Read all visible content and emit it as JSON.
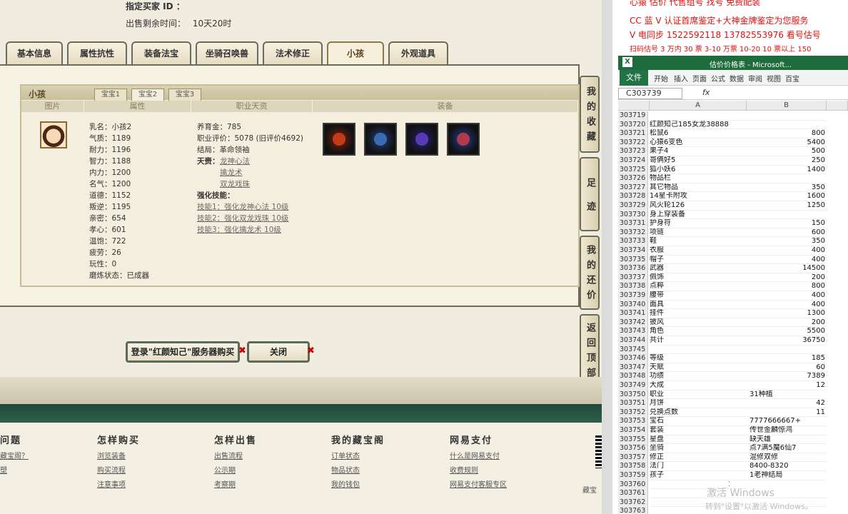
{
  "header": {
    "buyer_label": "指定买家 ID ：",
    "time_label": "出售剩余时间：",
    "time_value": "10天20时"
  },
  "tabs": [
    {
      "label": "基本信息"
    },
    {
      "label": "属性抗性"
    },
    {
      "label": "装备法宝"
    },
    {
      "label": "坐骑召唤兽"
    },
    {
      "label": "法术修正"
    },
    {
      "label": "小孩"
    },
    {
      "label": "外观道具"
    }
  ],
  "child_panel": {
    "title": "小孩",
    "subtabs": [
      "宝宝1",
      "宝宝2",
      "宝宝3"
    ],
    "columns": [
      "图片",
      "属性",
      "职业天资",
      "装备"
    ],
    "attributes": [
      "乳名：小孩2",
      "气质：1189",
      "耐力：1196",
      "智力：1188",
      "内力：1200",
      "名气：1200",
      "道德：1152",
      "叛逆：1195",
      "亲密：654",
      "孝心：601",
      "温饱：722",
      "疲劳：26",
      "玩性：0",
      "磨炼状态：已成器"
    ],
    "career": {
      "fee": "养育金：785",
      "rating": "职业评价：5078 (旧评价4692)",
      "ending": "结局：革命领袖",
      "talent_label": "天赍：",
      "talents": [
        "龙神心法",
        "擒龙术",
        "双龙戏珠"
      ],
      "skills_label": "强化技能：",
      "skills": [
        "技能1：强化龙神心法 10级",
        "技能2：强化双龙戏珠 10级",
        "技能3：强化擒龙术 10级"
      ]
    },
    "equip_icons": [
      "equip-1-icon",
      "equip-2-icon",
      "equip-3-icon",
      "equip-4-icon"
    ]
  },
  "side_buttons": [
    "我的收藏",
    "足迹",
    "我的还价",
    "返回顶部"
  ],
  "actions": {
    "login_buy": "登录\"红颜知己\"服务器购买",
    "close": "关闭",
    "x_mark": "✖"
  },
  "footer": {
    "sections": [
      {
        "title": "问题",
        "links": [
          "藏宝阁？",
          "塑"
        ]
      },
      {
        "title": "怎样购买",
        "links": [
          "浏览装备",
          "购买流程",
          "注意事项"
        ]
      },
      {
        "title": "怎样出售",
        "links": [
          "出售流程",
          "公示期",
          "考察期"
        ]
      },
      {
        "title": "我的藏宝阁",
        "links": [
          "订单状态",
          "物品状态",
          "我的钱包"
        ]
      },
      {
        "title": "网易支付",
        "links": [
          "什么是网易支付",
          "收费规则",
          "网易支付客服专区"
        ]
      }
    ],
    "corner_text": "藏宝"
  },
  "right_panel": {
    "banner": [
      "心猿 估价 代售组号 找号 免费配装",
      "CC 蓝 V 认证首席鉴定+大神金牌鉴定为您服务",
      "V 电同步 1522592118 13782553976 看号估号",
      "扫码估号 3 万内 30 票 3-10 万票 10-20 10 票以上 150"
    ],
    "window_title": "估价价格表 - Microsoft...",
    "ribbon_tabs": [
      "文件",
      "开始",
      "插入",
      "页面",
      "公式",
      "数据",
      "审阅",
      "视图",
      "百宝"
    ],
    "name_box": "C303739",
    "fx_label": "fx",
    "col_headers": [
      "A",
      "B"
    ],
    "rows": [
      {
        "n": "303719",
        "a": "",
        "b": ""
      },
      {
        "n": "303720",
        "a": "红颜知己185女龙38888",
        "b": ""
      },
      {
        "n": "303721",
        "a": "松鼠6",
        "b": "800"
      },
      {
        "n": "303722",
        "a": "心猿6变色",
        "b": "5400"
      },
      {
        "n": "303723",
        "a": "果子4",
        "b": "500"
      },
      {
        "n": "303724",
        "a": "哥俩好5",
        "b": "250"
      },
      {
        "n": "303725",
        "a": "狐小妖6",
        "b": "1400"
      },
      {
        "n": "303726",
        "a": "物品栏",
        "b": ""
      },
      {
        "n": "303727",
        "a": "其它物品",
        "b": "350"
      },
      {
        "n": "303728",
        "a": "14星卡附攻",
        "b": "1600"
      },
      {
        "n": "303729",
        "a": "风火轮126",
        "b": "1250"
      },
      {
        "n": "303730",
        "a": "身上穿装备",
        "b": ""
      },
      {
        "n": "303731",
        "a": "护身符",
        "b": "150"
      },
      {
        "n": "303732",
        "a": "项链",
        "b": "600"
      },
      {
        "n": "303733",
        "a": "鞋",
        "b": "350"
      },
      {
        "n": "303734",
        "a": "衣服",
        "b": "400"
      },
      {
        "n": "303735",
        "a": "帽子",
        "b": "400"
      },
      {
        "n": "303736",
        "a": "武器",
        "b": "14500"
      },
      {
        "n": "303737",
        "a": "佩饰",
        "b": "200"
      },
      {
        "n": "303738",
        "a": "点粹",
        "b": "800"
      },
      {
        "n": "303739",
        "a": "腰带",
        "b": "400"
      },
      {
        "n": "303740",
        "a": "面具",
        "b": "400"
      },
      {
        "n": "303741",
        "a": "挂件",
        "b": "1300"
      },
      {
        "n": "303742",
        "a": "披风",
        "b": "200"
      },
      {
        "n": "303743",
        "a": "角色",
        "b": "5500"
      },
      {
        "n": "303744",
        "a": "共计",
        "b": "36750"
      },
      {
        "n": "303745",
        "a": "",
        "b": ""
      },
      {
        "n": "303746",
        "a": "等级",
        "b": "185"
      },
      {
        "n": "303747",
        "a": "天赋",
        "b": "60"
      },
      {
        "n": "303748",
        "a": "功绩",
        "b": "7389"
      },
      {
        "n": "303749",
        "a": "大成",
        "b": "12"
      },
      {
        "n": "303750",
        "a": "职业",
        "b": "31种植",
        "t": true
      },
      {
        "n": "303751",
        "a": "月饼",
        "b": "42"
      },
      {
        "n": "303752",
        "a": "兑换点数",
        "b": "11"
      },
      {
        "n": "303753",
        "a": "宝石",
        "b": "7777666667+",
        "t": true
      },
      {
        "n": "303754",
        "a": "套装",
        "b": "传世金麟惊鸿",
        "t": true
      },
      {
        "n": "303755",
        "a": "星盘",
        "b": "缺天雄",
        "t": true
      },
      {
        "n": "303756",
        "a": "坐骑",
        "b": "点7满5魔6仙7",
        "t": true
      },
      {
        "n": "303757",
        "a": "修正",
        "b": "混修双修",
        "t": true
      },
      {
        "n": "303758",
        "a": "法门",
        "b": "8400-8320",
        "t": true
      },
      {
        "n": "303759",
        "a": "孩子",
        "b": "1老神结局",
        "t": true
      },
      {
        "n": "303760",
        "a": "",
        "b": "1",
        "c": true
      },
      {
        "n": "303761",
        "a": "",
        "b": ""
      },
      {
        "n": "303762",
        "a": "",
        "b": ""
      },
      {
        "n": "303763",
        "a": "",
        "b": ""
      }
    ],
    "watermark_1": "激活 Windows",
    "watermark_2": "转到\"设置\"以激活 Windows。"
  }
}
